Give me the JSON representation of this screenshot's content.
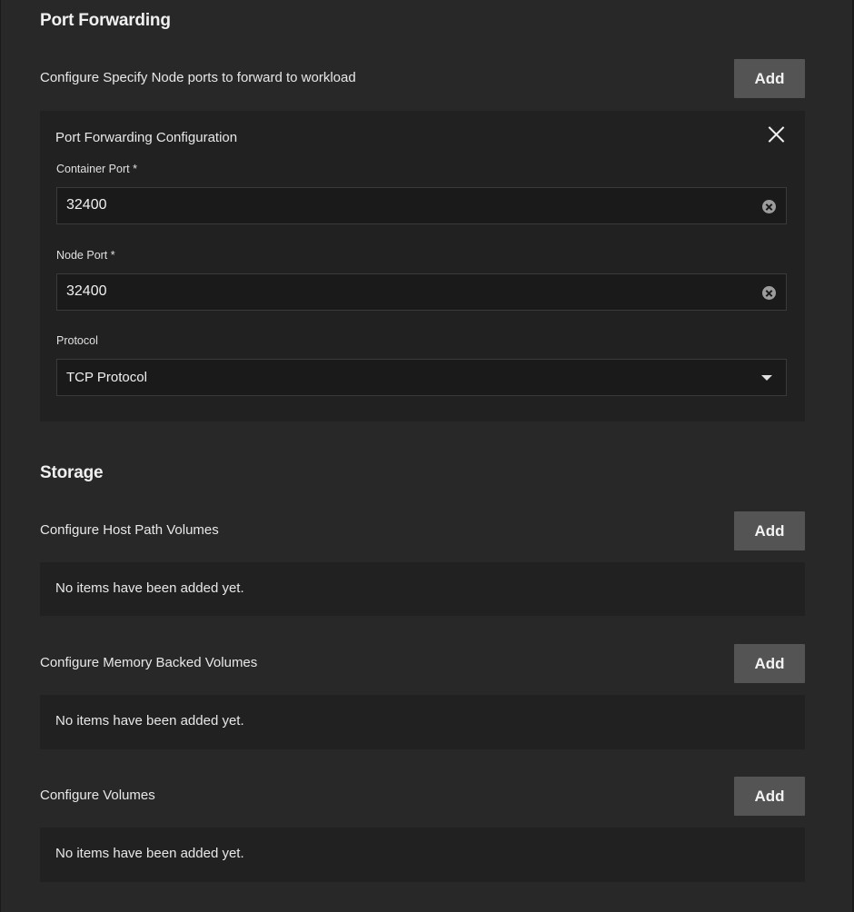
{
  "port_forwarding": {
    "title": "Port Forwarding",
    "configure_label": "Configure Specify Node ports to forward to workload",
    "add_label": "Add",
    "config": {
      "title": "Port Forwarding Configuration",
      "container_port": {
        "label": "Container Port *",
        "value": "32400"
      },
      "node_port": {
        "label": "Node Port *",
        "value": "32400"
      },
      "protocol": {
        "label": "Protocol",
        "selected": "TCP Protocol"
      }
    }
  },
  "storage": {
    "title": "Storage",
    "host_path": {
      "label": "Configure Host Path Volumes",
      "add_label": "Add",
      "empty_text": "No items have been added yet."
    },
    "memory_backed": {
      "label": "Configure Memory Backed Volumes",
      "add_label": "Add",
      "empty_text": "No items have been added yet."
    },
    "volumes": {
      "label": "Configure Volumes",
      "add_label": "Add",
      "empty_text": "No items have been added yet."
    }
  },
  "icons": {
    "close": "close-icon",
    "clear": "clear-icon",
    "dropdown": "chevron-down-icon"
  }
}
